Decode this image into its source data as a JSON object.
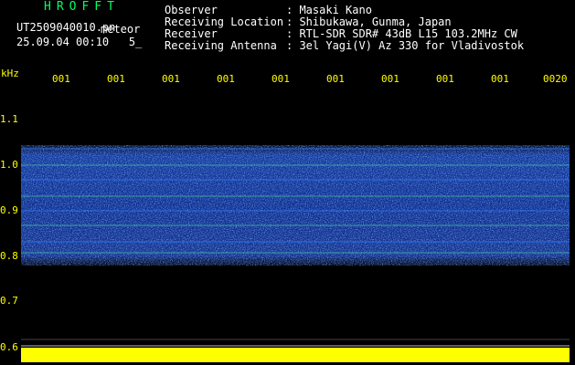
{
  "header": {
    "app_title": "HROFFT",
    "filename": "UT2509040010.pn",
    "mode": "meteor",
    "datetime": "25.09.04 00:10   5_",
    "labels": "Observer\nReceiving Location\nReceiver\nReceiving Antenna",
    "values": ": Masaki Kano\n: Shibukawa, Gunma, Japan\n: RTL-SDR SDR# 43dB L15 103.2MHz CW\n: 3el Yagi(V) Az 330 for Vladivostok"
  },
  "axes": {
    "unit": "kHz",
    "y_ticks": [
      "1.1",
      "1.0",
      "0.9",
      "0.8",
      "0.7",
      "0.6"
    ],
    "x_ticks": [
      "001",
      "001",
      "001",
      "001",
      "001",
      "001",
      "001",
      "001",
      "001",
      "0020"
    ]
  },
  "colors": {
    "label": "#ffff00",
    "title": "#00ff66",
    "text": "#ffffff",
    "background": "#000000",
    "signal_low": "#1030a0",
    "signal_high": "#30a0ff"
  }
}
